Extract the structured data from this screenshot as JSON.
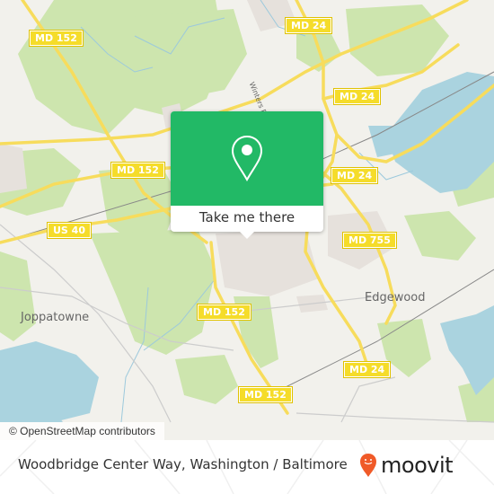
{
  "map": {
    "road_shields": [
      {
        "label": "MD 152",
        "id": "md152-nw"
      },
      {
        "label": "MD 24",
        "id": "md24-north"
      },
      {
        "label": "MD 24",
        "id": "md24-east"
      },
      {
        "label": "MD 152",
        "id": "md152-center"
      },
      {
        "label": "MD 24",
        "id": "md24-mid"
      },
      {
        "label": "US 40",
        "id": "us40"
      },
      {
        "label": "MD 755",
        "id": "md755"
      },
      {
        "label": "MD 152",
        "id": "md152-south"
      },
      {
        "label": "MD 24",
        "id": "md24-south"
      },
      {
        "label": "MD 152",
        "id": "md152-bottom"
      }
    ],
    "places": {
      "joppatowne": "Joppatowne",
      "edgewood": "Edgewood"
    },
    "road_names": {
      "winters_run": "Winters R"
    },
    "colors": {
      "land": "#f2f1ec",
      "forest": "#cde5ae",
      "water": "#aad3df",
      "road": "#f7dc5c",
      "residential": "#e6e1dc"
    }
  },
  "popup": {
    "icon": "location-pin-icon",
    "button_label": "Take me there",
    "color": "#22b966"
  },
  "attribution": "© OpenStreetMap contributors",
  "footer": {
    "title": "Woodbridge Center Way, Washington / Baltimore",
    "brand": "moovit",
    "brand_color": "#f05a28"
  }
}
